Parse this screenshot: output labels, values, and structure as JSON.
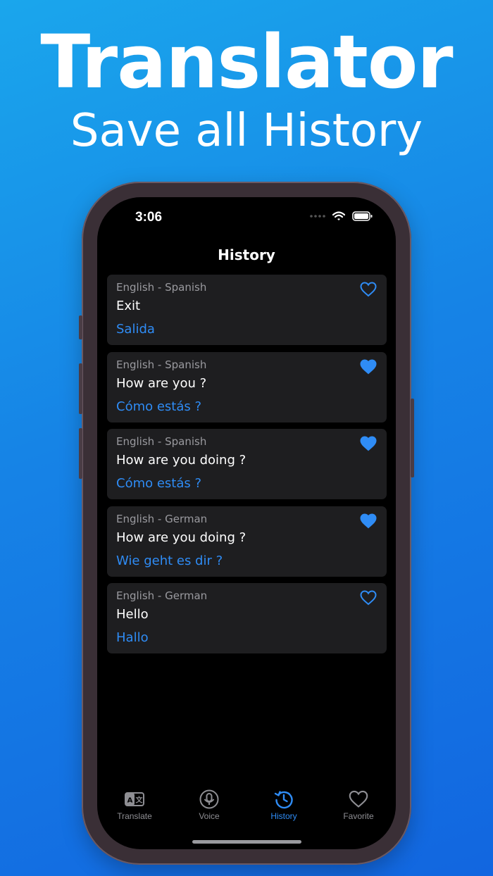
{
  "promo": {
    "title": "Translator",
    "subtitle": "Save all History"
  },
  "status_bar": {
    "time": "3:06"
  },
  "screen": {
    "title": "History"
  },
  "history": [
    {
      "pair": "English - Spanish",
      "source": "Exit",
      "target": "Salida",
      "favorite": false
    },
    {
      "pair": "English - Spanish",
      "source": "How are you ?",
      "target": "Cómo estás ?",
      "favorite": true
    },
    {
      "pair": "English - Spanish",
      "source": "How are you doing ?",
      "target": "Cómo estás ?",
      "favorite": true
    },
    {
      "pair": "English - German",
      "source": "How are you doing ?",
      "target": "Wie geht es dir ?",
      "favorite": true
    },
    {
      "pair": "English - German",
      "source": "Hello",
      "target": "Hallo",
      "favorite": false
    }
  ],
  "tabs": [
    {
      "label": "Translate",
      "icon": "translate-icon",
      "active": false
    },
    {
      "label": "Voice",
      "icon": "microphone-icon",
      "active": false
    },
    {
      "label": "History",
      "icon": "history-icon",
      "active": true
    },
    {
      "label": "Favorite",
      "icon": "heart-icon",
      "active": false
    }
  ],
  "colors": {
    "accent": "#2f8cf5",
    "background_gradient": [
      "#1aa6ec",
      "#1266e0"
    ],
    "card": "#1e1e20",
    "inactive": "#8e8e93"
  }
}
